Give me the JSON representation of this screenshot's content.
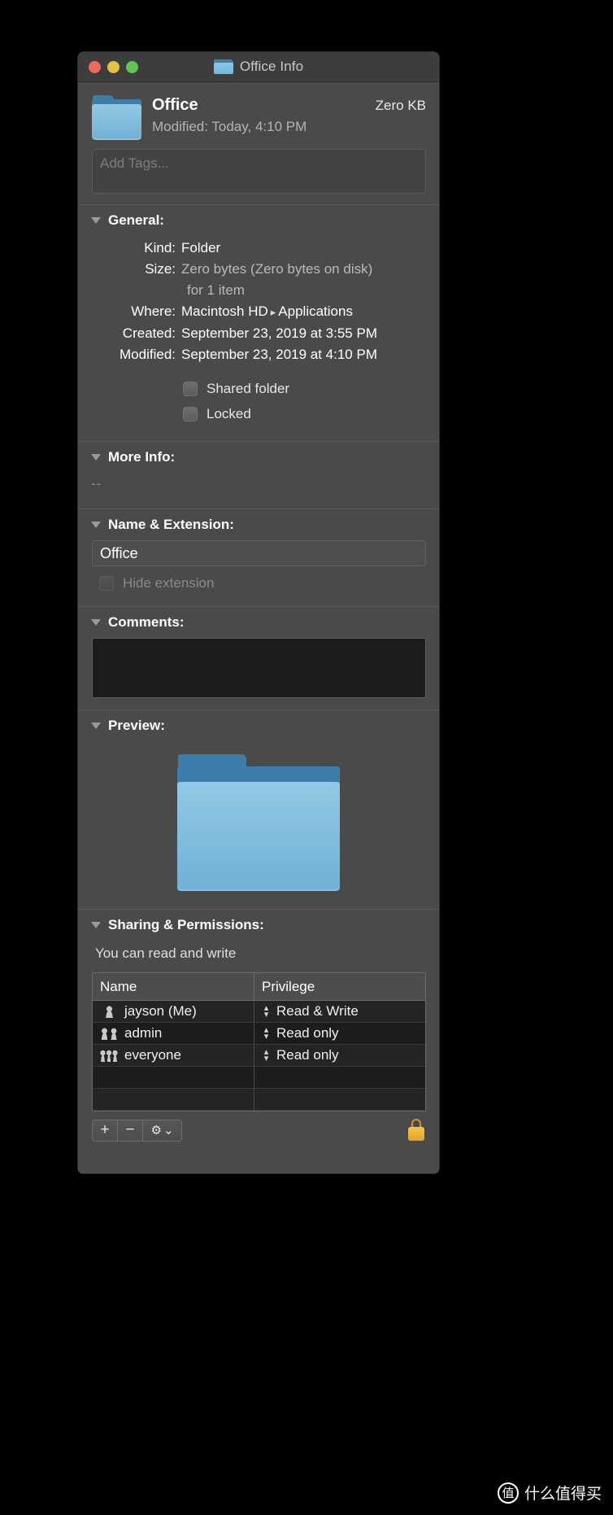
{
  "window": {
    "title": "Office Info",
    "title_icon": "folder-icon",
    "traffic_lights": {
      "close_color": "#ec6a5e",
      "minimize_color": "#e3c144",
      "zoom_color": "#62c454"
    }
  },
  "header": {
    "name": "Office",
    "modified": "Modified: Today, 4:10 PM",
    "size": "Zero KB",
    "icon": "folder-icon"
  },
  "tags": {
    "placeholder": "Add Tags..."
  },
  "sections": {
    "general": {
      "title": "General:",
      "rows": [
        {
          "label": "Kind:",
          "value": "Folder",
          "dim": false
        },
        {
          "label": "Size:",
          "value": "Zero bytes (Zero bytes on disk)",
          "dim": true
        },
        {
          "label": "",
          "value": "for 1 item",
          "dim": true
        },
        {
          "label": "Where:",
          "value": "Macintosh HD",
          "value2": "Applications",
          "dim": false
        },
        {
          "label": "Created:",
          "value": "September 23, 2019 at 3:55 PM",
          "dim": false
        },
        {
          "label": "Modified:",
          "value": "September 23, 2019 at 4:10 PM",
          "dim": false
        }
      ],
      "checkboxes": [
        {
          "label": "Shared folder",
          "checked": false,
          "disabled": false
        },
        {
          "label": "Locked",
          "checked": false,
          "disabled": false
        }
      ]
    },
    "more_info": {
      "title": "More Info:",
      "value": "--"
    },
    "name_extension": {
      "title": "Name & Extension:",
      "name_value": "Office",
      "hide_extension_label": "Hide extension",
      "hide_extension_checked": false
    },
    "comments": {
      "title": "Comments:",
      "value": ""
    },
    "preview": {
      "title": "Preview:",
      "icon": "folder-icon"
    },
    "sharing": {
      "title": "Sharing & Permissions:",
      "status": "You can read and write",
      "columns": [
        "Name",
        "Privilege"
      ],
      "rows": [
        {
          "icon": "single-user-icon",
          "name": "jayson (Me)",
          "privilege": "Read & Write"
        },
        {
          "icon": "two-users-icon",
          "name": "admin",
          "privilege": "Read only"
        },
        {
          "icon": "three-users-icon",
          "name": "everyone",
          "privilege": "Read only"
        }
      ],
      "empty_rows": 2,
      "toolbar": {
        "add_label": "+",
        "remove_label": "−",
        "action_label": "⚙",
        "action_chevron": "⌄",
        "lock_state": "locked"
      }
    }
  },
  "watermark": {
    "badge": "值",
    "text": "什么值得买"
  }
}
